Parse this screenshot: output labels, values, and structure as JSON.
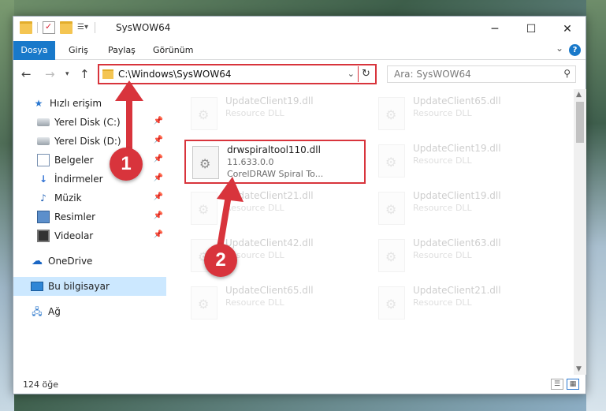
{
  "window": {
    "title": "SysWOW64"
  },
  "ribbon": {
    "tabs": [
      "Dosya",
      "Giriş",
      "Paylaş",
      "Görünüm"
    ]
  },
  "address": {
    "path": "C:\\Windows\\SysWOW64",
    "search_placeholder": "Ara: SysWOW64"
  },
  "sidebar": {
    "items": [
      {
        "label": "Hızlı erişim",
        "icon": "star-icon"
      },
      {
        "label": "Yerel Disk (C:)",
        "icon": "disk-icon"
      },
      {
        "label": "Yerel Disk (D:)",
        "icon": "disk-icon"
      },
      {
        "label": "Belgeler",
        "icon": "documents-icon"
      },
      {
        "label": "İndirmeler",
        "icon": "download-icon"
      },
      {
        "label": "Müzik",
        "icon": "music-icon"
      },
      {
        "label": "Resimler",
        "icon": "pictures-icon"
      },
      {
        "label": "Videolar",
        "icon": "videos-icon"
      },
      {
        "label": "OneDrive",
        "icon": "cloud-icon"
      },
      {
        "label": "Bu bilgisayar",
        "icon": "computer-icon"
      },
      {
        "label": "Ağ",
        "icon": "network-icon"
      }
    ]
  },
  "files": {
    "left": [
      {
        "name": "UpdateClient19.dll",
        "type": "Resource DLL"
      },
      {
        "name": "drwspiraltool110.dll",
        "version": "11.633.0.0",
        "desc": "CorelDRAW Spiral To..."
      },
      {
        "name": "UpdateClient21.dll",
        "type": "Resource DLL"
      },
      {
        "name": "UpdateClient42.dll",
        "type": "Resource DLL"
      },
      {
        "name": "UpdateClient65.dll",
        "type": "Resource DLL"
      }
    ],
    "right": [
      {
        "name": "UpdateClient65.dll",
        "type": "Resource DLL"
      },
      {
        "name": "UpdateClient19.dll",
        "type": "Resource DLL"
      },
      {
        "name": "UpdateClient19.dll",
        "type": "Resource DLL"
      },
      {
        "name": "UpdateClient63.dll",
        "type": "Resource DLL"
      },
      {
        "name": "UpdateClient21.dll",
        "type": "Resource DLL"
      }
    ]
  },
  "status": {
    "count": "124 öğe"
  },
  "annotations": {
    "step1": "1",
    "step2": "2",
    "color": "#d8343c"
  }
}
